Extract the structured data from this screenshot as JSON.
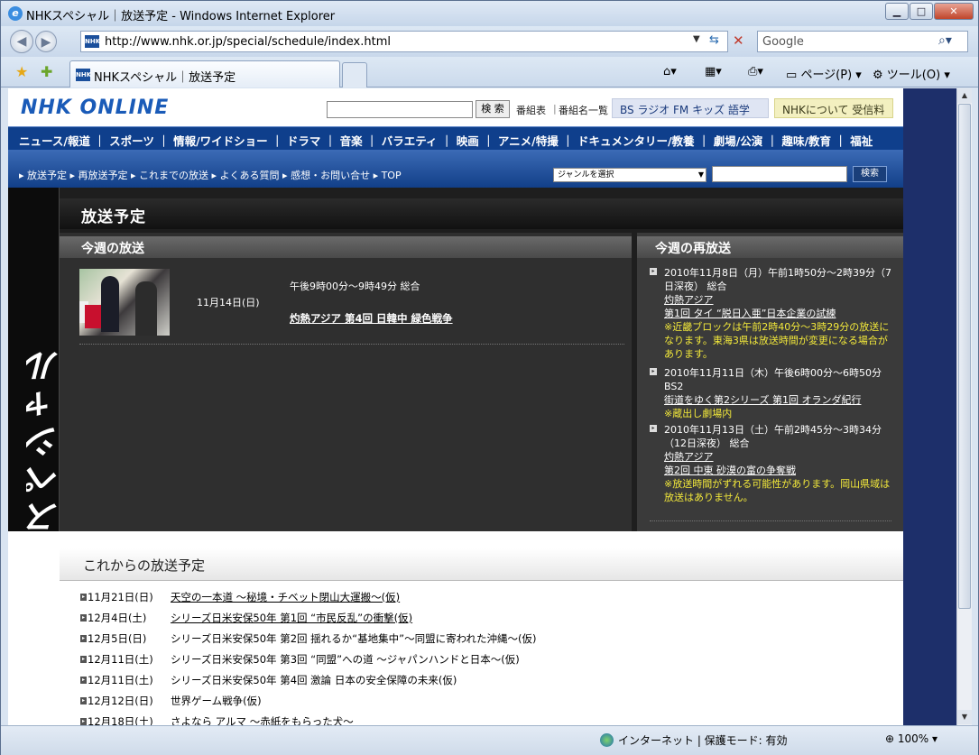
{
  "window": {
    "title": "NHKスペシャル｜放送予定 - Windows Internet Explorer",
    "url": "http://www.nhk.or.jp/special/schedule/index.html",
    "search_placeholder": "Google",
    "tab_title": "NHKスペシャル｜放送予定",
    "page_menu": "ページ(P)",
    "tools_menu": "ツール(O)"
  },
  "status": {
    "zone": "インターネット | 保護モード: 有効",
    "zoom": "100%"
  },
  "header": {
    "logo": "NHK ONLINE",
    "search_button": "検 索",
    "links": [
      "番組表",
      "番組名一覧"
    ],
    "bs_links": "BS  ラジオ  FM  キッズ  語学",
    "about_links": "NHKについて  受信料"
  },
  "genre_nav": "ニュース/報道 ｜ スポーツ ｜ 情報/ワイドショー ｜ ドラマ ｜ 音楽 ｜ バラエティ ｜ 映画 ｜ アニメ/特撮 ｜ ドキュメンタリー/教養 ｜ 劇場/公演 ｜ 趣味/教育 ｜ 福祉",
  "subnav": {
    "links": "▸ 放送予定  ▸ 再放送予定  ▸ これまでの放送  ▸ よくある質問  ▸ 感想・お問い合せ     ▸ TOP",
    "genre_select": "ジャンルを選択",
    "search_button": "検索"
  },
  "brand_vertical": "NHKスペシャル",
  "page_title": "放送予定",
  "this_week": {
    "heading": "今週の放送",
    "date": "11月14日(日)",
    "time": "午後9時00分〜9時49分  総合",
    "program": "灼熱アジア  第4回  日韓中  緑色戦争"
  },
  "rerun": {
    "heading": "今週の再放送",
    "items": [
      {
        "when": "2010年11月8日（月）午前1時50分〜2時39分（7日深夜） 総合",
        "series": "灼熱アジア",
        "program": "第1回  タイ  “脱日入亜”日本企業の試練",
        "note": "※近畿ブロックは午前2時40分〜3時29分の放送になります。東海3県は放送時間が変更になる場合があります。"
      },
      {
        "when": "2010年11月11日（木）午後6時00分〜6時50分  BS2",
        "series": "",
        "program": "街道をゆく第2シリーズ  第1回  オランダ紀行",
        "note": "※蔵出し劇場内"
      },
      {
        "when": "2010年11月13日（土）午前2時45分〜3時34分（12日深夜） 総合",
        "series": "灼熱アジア",
        "program": "第2回  中東  砂漠の富の争奪戦",
        "note": "※放送時間がずれる可能性があります。岡山県域は放送はありません。"
      }
    ]
  },
  "upcoming": {
    "heading": "これからの放送予定",
    "items": [
      {
        "date": "11月21日(日)",
        "program": "天空の一本道  〜秘境・チベット閉山大運搬〜(仮)",
        "link": true
      },
      {
        "date": "12月4日(土)",
        "program": "シリーズ日米安保50年  第1回  “市民反乱”の衝撃(仮)",
        "link": true
      },
      {
        "date": "12月5日(日)",
        "program": "シリーズ日米安保50年  第2回  揺れるか“基地集中”〜同盟に寄われた沖縄〜(仮)",
        "link": false
      },
      {
        "date": "12月11日(土)",
        "program": "シリーズ日米安保50年  第3回  “同盟”への道  〜ジャパンハンドと日本〜(仮)",
        "link": false
      },
      {
        "date": "12月11日(土)",
        "program": "シリーズ日米安保50年  第4回  激論  日本の安全保障の未来(仮)",
        "link": false
      },
      {
        "date": "12月12日(日)",
        "program": "世界ゲーム戦争(仮)",
        "link": false
      },
      {
        "date": "12月18日(土)",
        "program": "さよなら  アルマ  〜赤紙をもらった犬〜",
        "link": false
      }
    ]
  }
}
